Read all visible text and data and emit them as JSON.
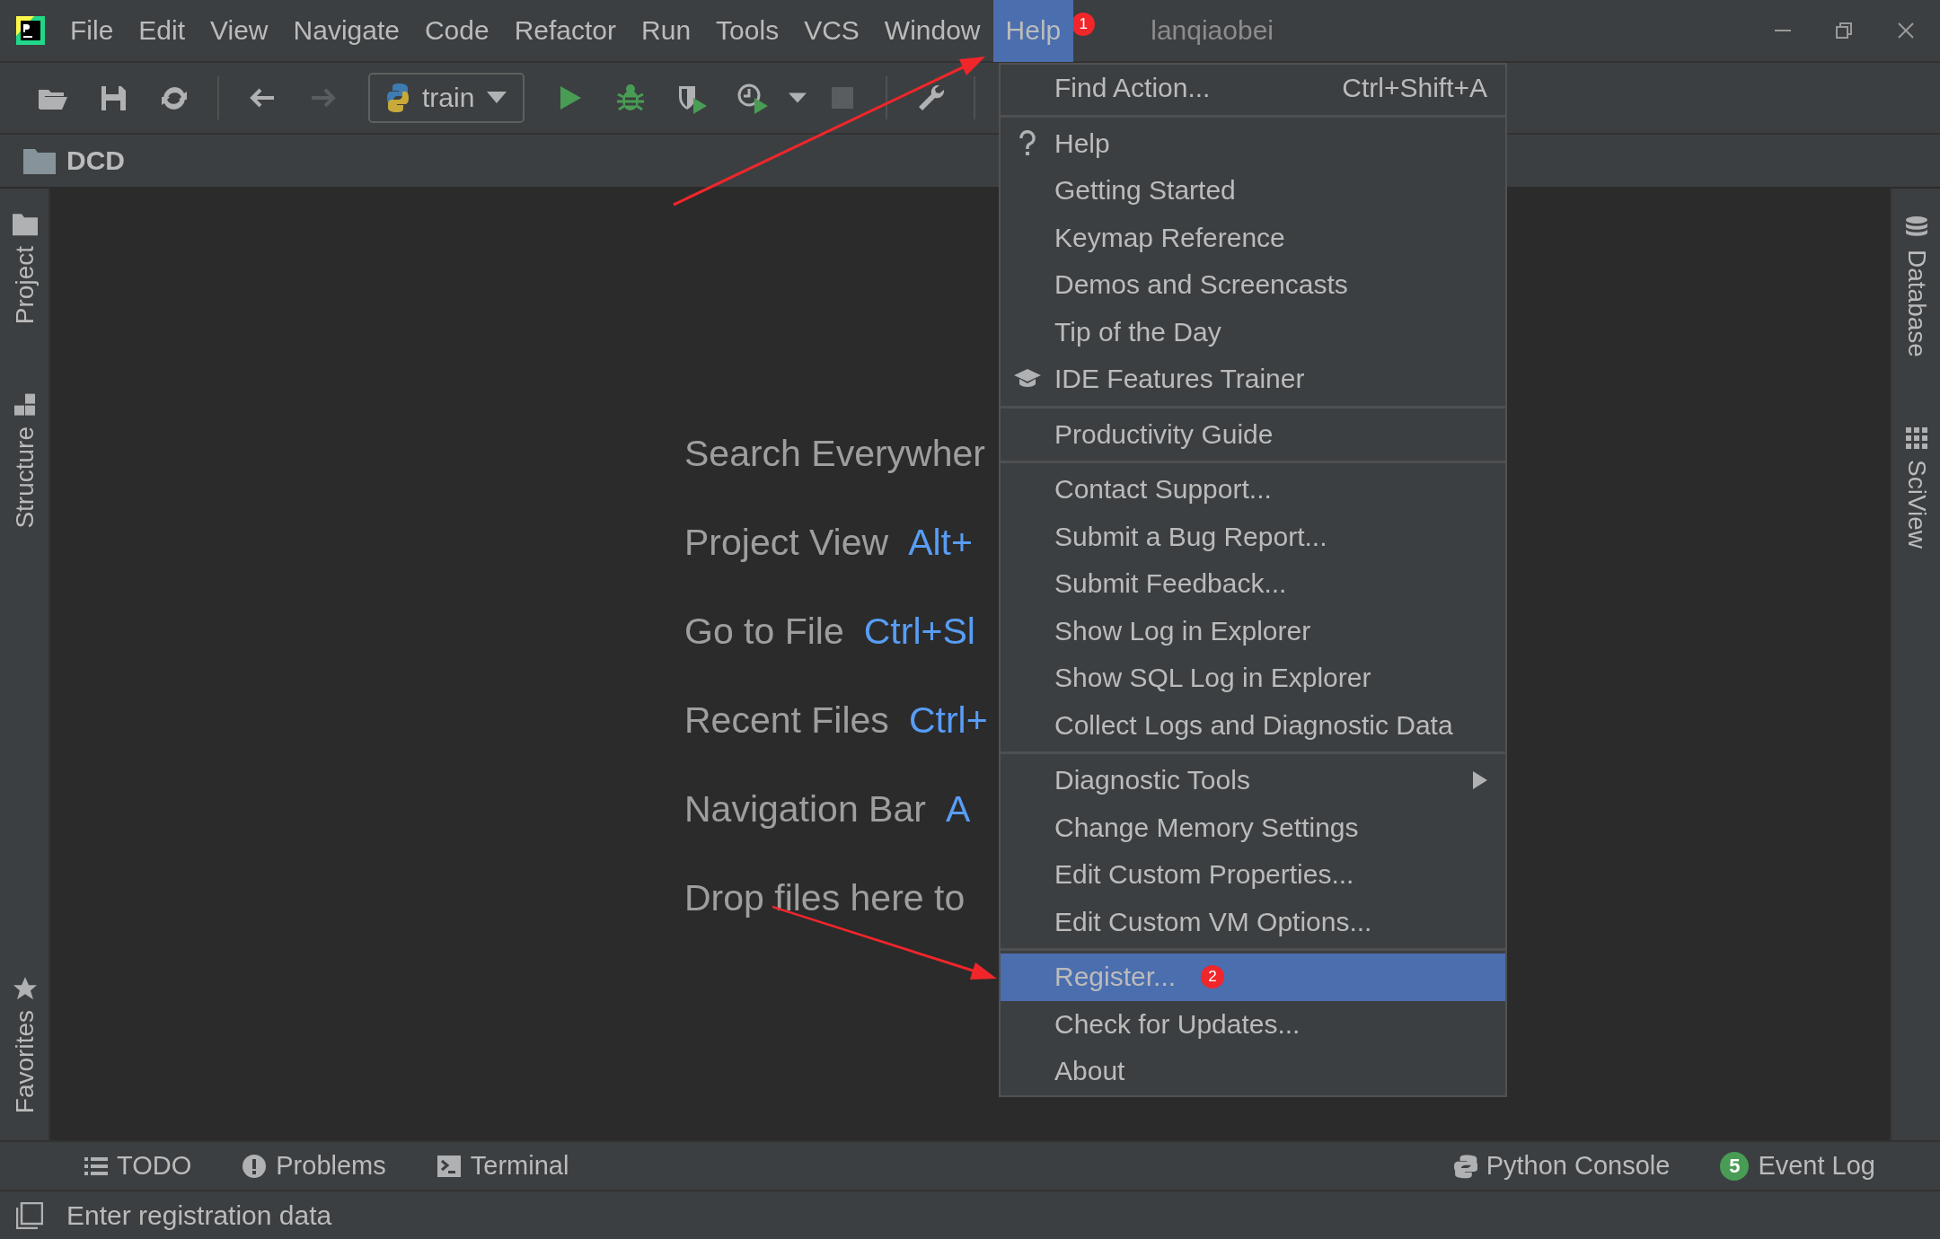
{
  "window": {
    "title": "lanqiaobei"
  },
  "menu_bar": [
    {
      "label": "File",
      "selected": false
    },
    {
      "label": "Edit",
      "selected": false
    },
    {
      "label": "View",
      "selected": false
    },
    {
      "label": "Navigate",
      "selected": false
    },
    {
      "label": "Code",
      "selected": false
    },
    {
      "label": "Refactor",
      "selected": false
    },
    {
      "label": "Run",
      "selected": false
    },
    {
      "label": "Tools",
      "selected": false
    },
    {
      "label": "VCS",
      "selected": false
    },
    {
      "label": "Window",
      "selected": false
    },
    {
      "label": "Help",
      "selected": true,
      "badge": "1"
    }
  ],
  "toolbar": {
    "run_configuration": "train",
    "items": [
      {
        "kind": "open",
        "disabled": false
      },
      {
        "kind": "save",
        "disabled": false
      },
      {
        "kind": "sync",
        "disabled": false
      },
      {
        "kind": "separator"
      },
      {
        "kind": "back",
        "disabled": false
      },
      {
        "kind": "forward",
        "disabled": true
      },
      {
        "kind": "config"
      },
      {
        "kind": "run",
        "disabled": false
      },
      {
        "kind": "debug",
        "disabled": false
      },
      {
        "kind": "coverage",
        "disabled": false
      },
      {
        "kind": "profile",
        "disabled": false
      },
      {
        "kind": "more",
        "disabled": false
      },
      {
        "kind": "stop",
        "disabled": true
      },
      {
        "kind": "separator"
      },
      {
        "kind": "settings",
        "disabled": false
      },
      {
        "kind": "separator"
      }
    ]
  },
  "navigation_bar": {
    "path": "DCD"
  },
  "left_stripe": [
    {
      "label": "Project",
      "kind": "project"
    },
    {
      "label": "Structure",
      "kind": "structure"
    },
    {
      "label": "Favorites",
      "kind": "favorites"
    }
  ],
  "right_stripe": [
    {
      "label": "Database",
      "kind": "database"
    },
    {
      "label": "SciView",
      "kind": "sciview"
    }
  ],
  "welcome": [
    {
      "label": "Search Everywher"
    },
    {
      "label": "Project View",
      "shortcut": "Alt+"
    },
    {
      "label": "Go to File",
      "shortcut": "Ctrl+Sl"
    },
    {
      "label": "Recent Files",
      "shortcut": "Ctrl+"
    },
    {
      "label": "Navigation Bar",
      "shortcut": "A"
    },
    {
      "label": "Drop files here to"
    }
  ],
  "help_menu": {
    "groups": [
      [
        {
          "label": "Find Action...",
          "shortcut": "Ctrl+Shift+A",
          "kind": "plain",
          "selected": false
        }
      ],
      [
        {
          "label": "Help",
          "kind": "help",
          "selected": false
        },
        {
          "label": "Getting Started",
          "kind": "plain",
          "selected": false
        },
        {
          "label": "Keymap Reference",
          "kind": "plain",
          "selected": false
        },
        {
          "label": "Demos and Screencasts",
          "kind": "plain",
          "selected": false
        },
        {
          "label": "Tip of the Day",
          "kind": "plain",
          "selected": false
        },
        {
          "label": "IDE Features Trainer",
          "kind": "trainer",
          "selected": false
        }
      ],
      [
        {
          "label": "Productivity Guide",
          "kind": "plain",
          "selected": false
        }
      ],
      [
        {
          "label": "Contact Support...",
          "kind": "plain",
          "selected": false
        },
        {
          "label": "Submit a Bug Report...",
          "kind": "plain",
          "selected": false
        },
        {
          "label": "Submit Feedback...",
          "kind": "plain",
          "selected": false
        },
        {
          "label": "Show Log in Explorer",
          "kind": "plain",
          "selected": false
        },
        {
          "label": "Show SQL Log in Explorer",
          "kind": "plain",
          "selected": false
        },
        {
          "label": "Collect Logs and Diagnostic Data",
          "kind": "plain",
          "selected": false
        }
      ],
      [
        {
          "label": "Diagnostic Tools",
          "kind": "submenu",
          "selected": false
        },
        {
          "label": "Change Memory Settings",
          "kind": "plain",
          "selected": false
        },
        {
          "label": "Edit Custom Properties...",
          "kind": "plain",
          "selected": false
        },
        {
          "label": "Edit Custom VM Options...",
          "kind": "plain",
          "selected": false
        }
      ],
      [
        {
          "label": "Register...",
          "kind": "plain",
          "selected": true,
          "badge": "2"
        },
        {
          "label": "Check for Updates...",
          "kind": "plain",
          "selected": false
        },
        {
          "label": "About",
          "kind": "plain",
          "selected": false
        }
      ]
    ]
  },
  "tool_window_bar": {
    "left": [
      {
        "label": "TODO",
        "kind": "todo"
      },
      {
        "label": "Problems",
        "kind": "problems"
      },
      {
        "label": "Terminal",
        "kind": "terminal"
      }
    ],
    "right": [
      {
        "label": "Python Console",
        "kind": "python"
      },
      {
        "label": "Event Log",
        "kind": "event-log",
        "badge": "5"
      }
    ]
  },
  "status_bar": {
    "message": "Enter registration data"
  }
}
